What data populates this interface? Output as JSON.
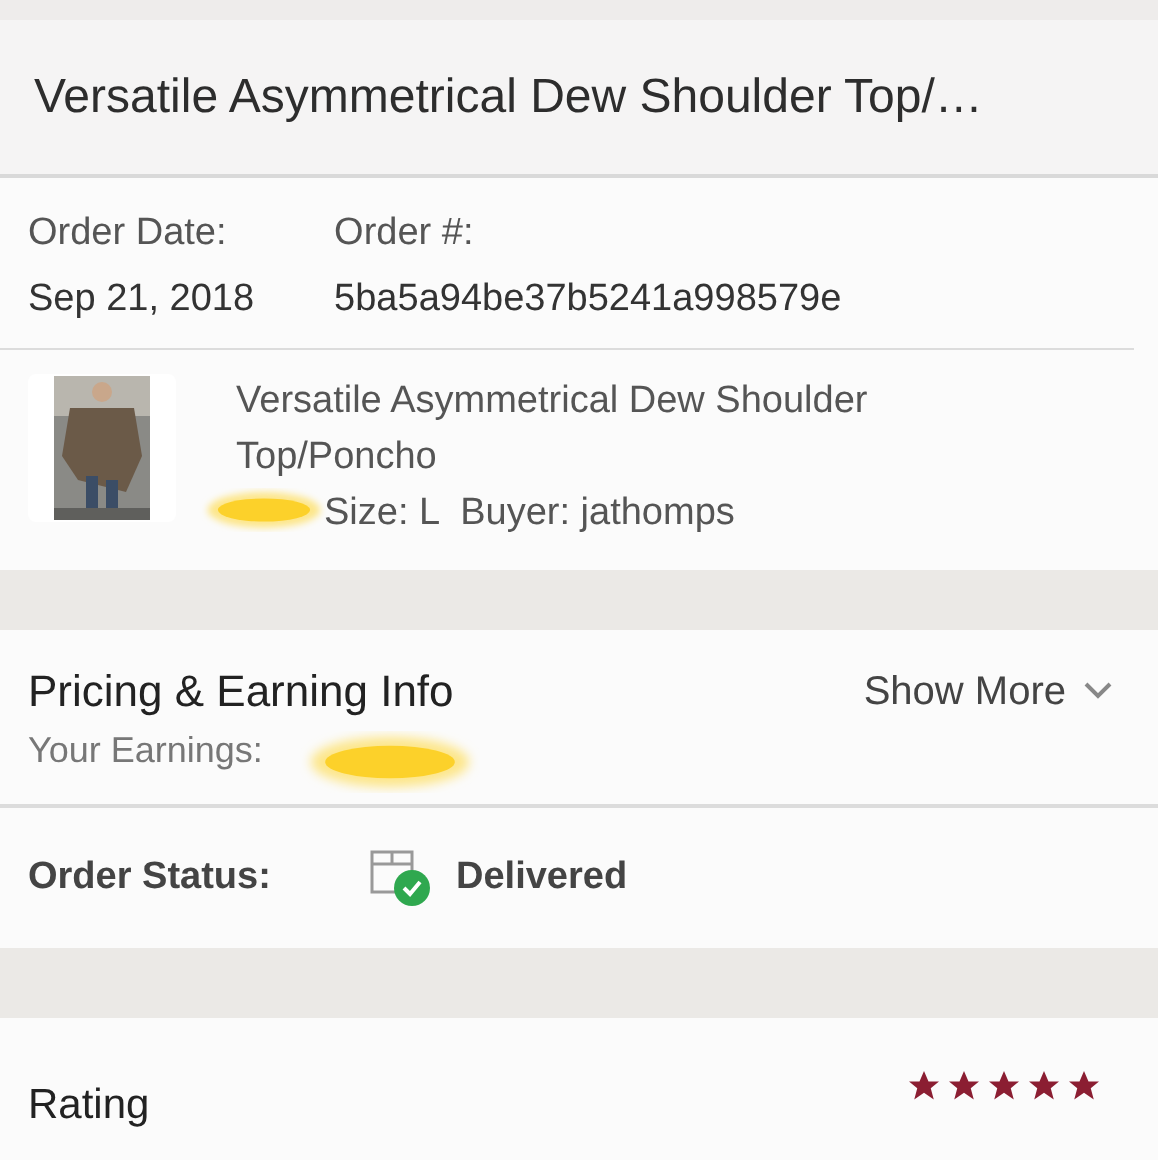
{
  "header": {
    "title": "Versatile Asymmetrical Dew Shoulder Top/…"
  },
  "order": {
    "date_label": "Order Date:",
    "date": "Sep 21, 2018",
    "number_label": "Order #:",
    "number": "5ba5a94be37b5241a998579e"
  },
  "item": {
    "kind": "picture",
    "title": "Versatile Asymmetrical Dew Shoulder Top/Poncho",
    "size": "Size: L",
    "buyer": "Buyer: jathomps"
  },
  "pricing": {
    "title": "Pricing & Earning Info",
    "earnings_label": "Your Earnings:",
    "show_more": "Show More"
  },
  "status": {
    "label": "Order Status:",
    "value": "Delivered"
  },
  "rating": {
    "label": "Rating",
    "stars": 5
  }
}
